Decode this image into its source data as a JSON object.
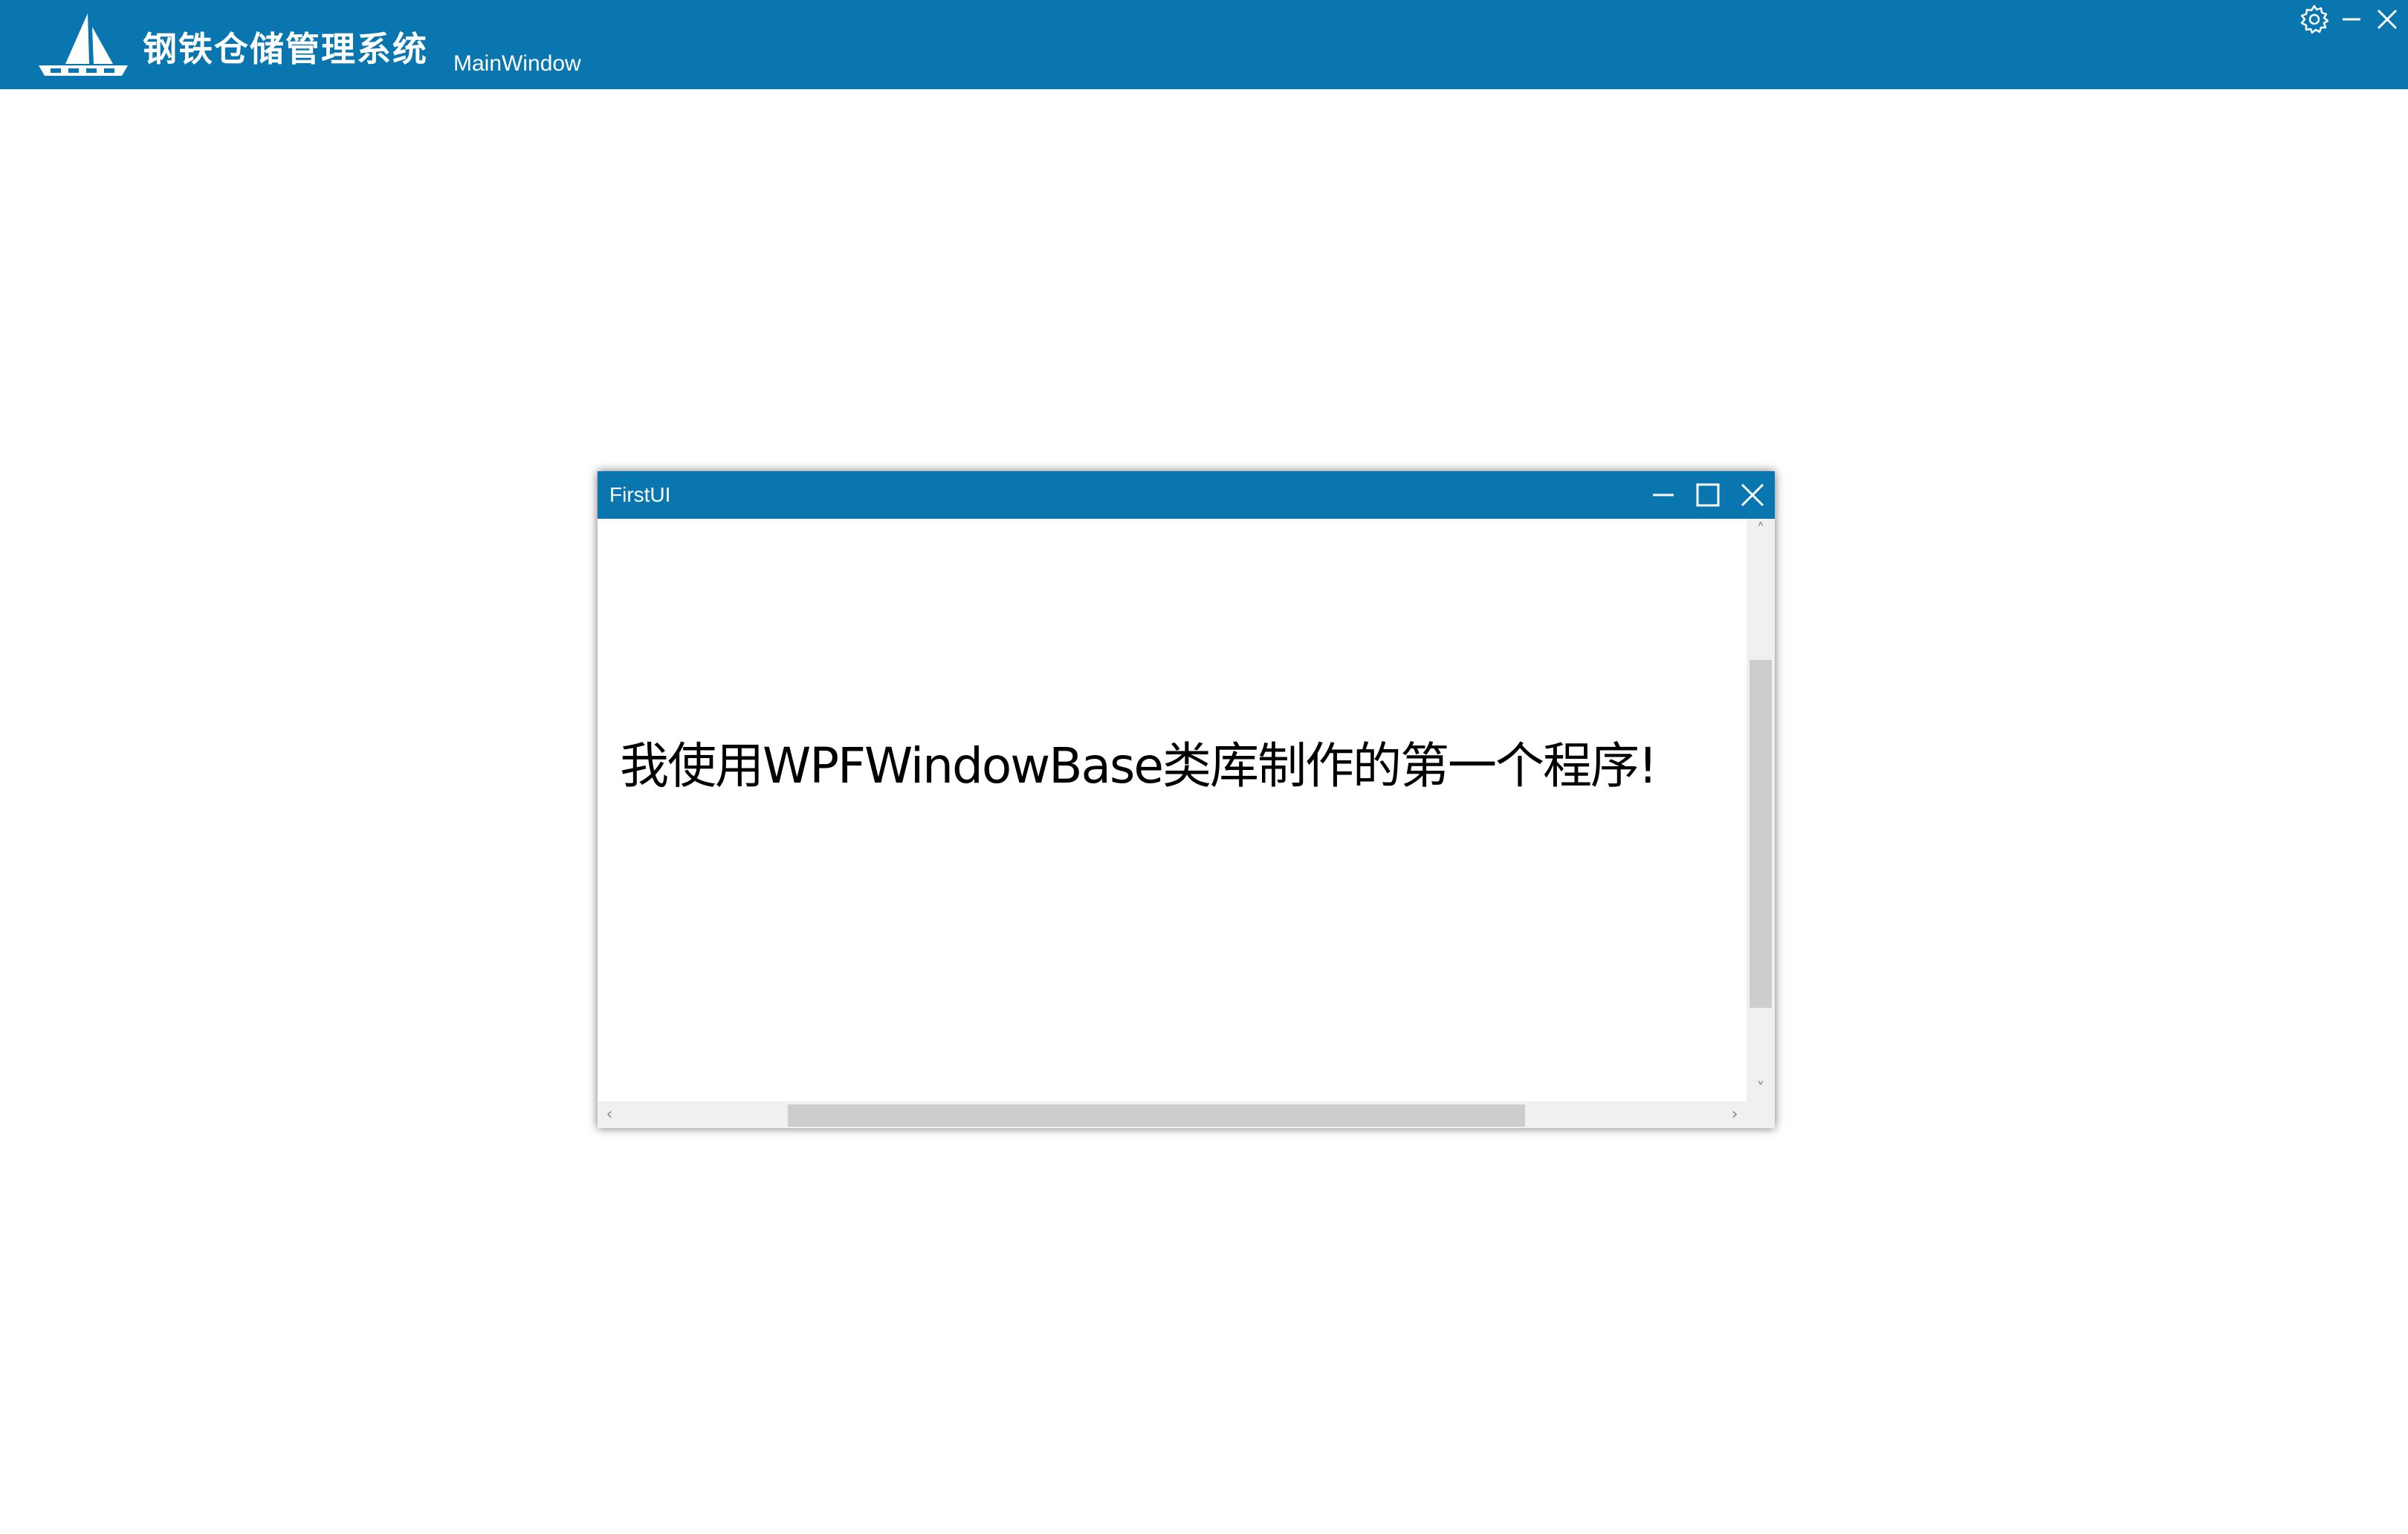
{
  "main_window": {
    "app_title": "钢铁仓储管理系统",
    "window_name": "MainWindow",
    "logo_icon": "sailboat-logo-icon",
    "controls": {
      "settings_icon": "gear-icon",
      "minimize_icon": "minimize-icon",
      "close_icon": "close-icon"
    }
  },
  "child_window": {
    "title": "FirstUI",
    "controls": {
      "minimize_icon": "minimize-icon",
      "maximize_icon": "maximize-icon",
      "close_icon": "close-icon"
    },
    "message": "我使用WPFWindowBase类库制作的第一个程序!",
    "scrollbars": {
      "vertical": {
        "up_arrow": "˄",
        "down_arrow": "˅"
      },
      "horizontal": {
        "left_arrow": "‹",
        "right_arrow": "›"
      }
    }
  },
  "colors": {
    "titlebar": "#0a76b0",
    "title_text": "#ffffff",
    "content_bg": "#ffffff",
    "scroll_track": "#f0f0f0",
    "scroll_thumb": "#cdcdcd"
  }
}
